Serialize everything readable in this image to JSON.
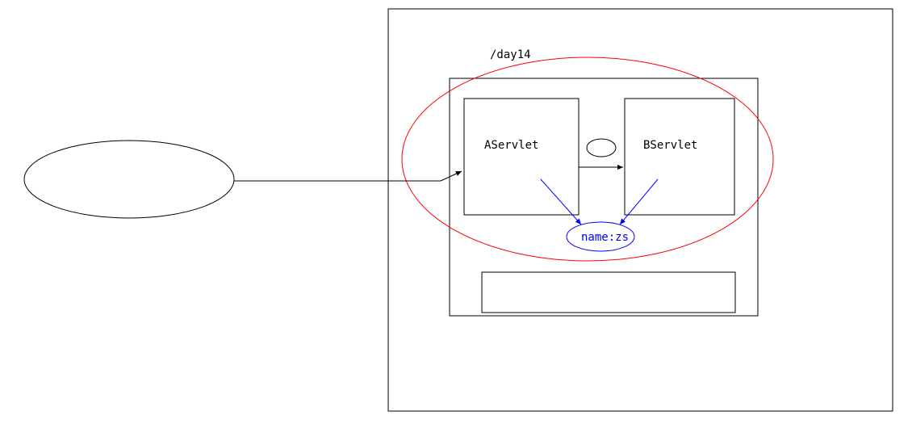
{
  "container_label": "/day14",
  "servlet_a": "AServlet",
  "servlet_b": "BServlet",
  "attr_text": "name:zs"
}
